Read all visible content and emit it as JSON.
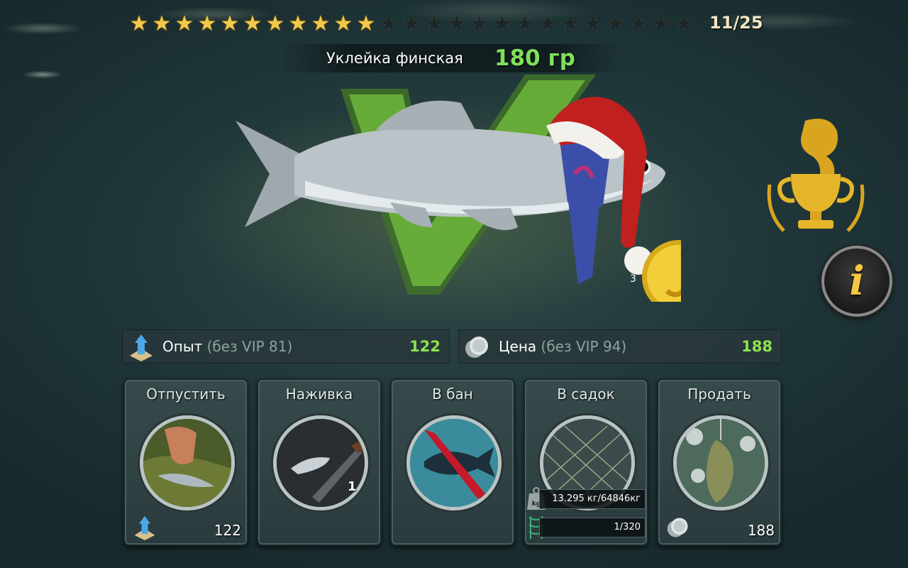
{
  "stars": {
    "filled": 11,
    "total": 25,
    "count_label": "11/25"
  },
  "fish": {
    "name": "Уклейка финская",
    "weight": "180 гр"
  },
  "stats": {
    "xp": {
      "label": "Опыт",
      "sub": "(без VIP 81)",
      "value": "122"
    },
    "price": {
      "label": "Цена",
      "sub": "(без VIP 94)",
      "value": "188"
    }
  },
  "actions": [
    {
      "title": "Отпустить",
      "value": "122"
    },
    {
      "title": "Наживка",
      "count": "1"
    },
    {
      "title": "В бан"
    },
    {
      "title": "В садок",
      "weight": "13.295 кг/64846кг",
      "slots": "1/320"
    },
    {
      "title": "Продать",
      "value": "188"
    }
  ],
  "coin_partial_digit": "3",
  "info_label": "i",
  "colors": {
    "accent_green": "#7fe05a",
    "value_green": "#8fe34f",
    "star_gold": "#f2c94a",
    "coin_gold": "#f5c842"
  },
  "icons": [
    "trophy-icon",
    "info-icon",
    "coin-icon",
    "xp-icon",
    "silver-coin-icon",
    "kg-weight-icon",
    "net-icon"
  ]
}
